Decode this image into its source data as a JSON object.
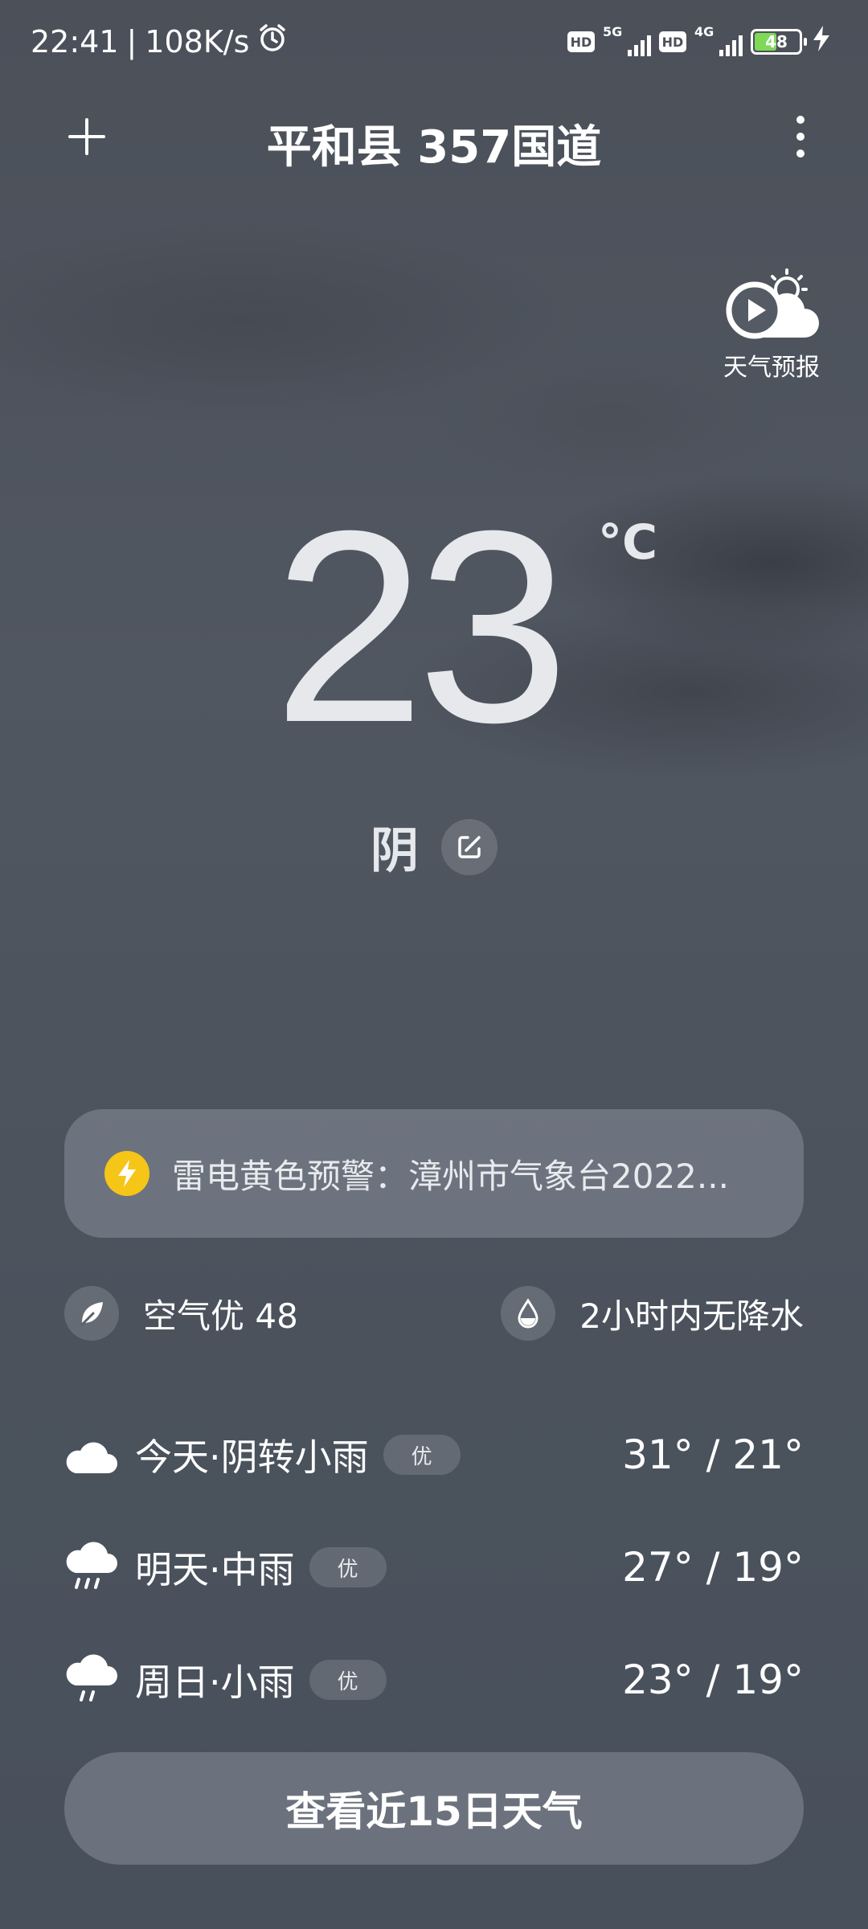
{
  "status_bar": {
    "time": "22:41",
    "separator": "|",
    "speed": "108K/s",
    "net1": "5G",
    "net2": "4G",
    "hd1": "HD",
    "hd2": "HD",
    "battery": "48",
    "icons": [
      "alarm-icon",
      "hd-icon",
      "signal-icon",
      "battery-icon",
      "charging-icon"
    ]
  },
  "header": {
    "title": "平和县 357国道"
  },
  "forecast_video": {
    "label": "天气预报"
  },
  "current": {
    "temperature": "23",
    "unit": "°C",
    "condition": "阴"
  },
  "warning": {
    "text": "雷电黄色预警：漳州市气象台2022..."
  },
  "air_quality": {
    "text": "空气优 48"
  },
  "precipitation": {
    "text": "2小时内无降水"
  },
  "forecast": [
    {
      "label": "今天·阴转小雨",
      "aq": "优",
      "temps": "31° / 21°",
      "icon": "cloud-icon"
    },
    {
      "label": "明天·中雨",
      "aq": "优",
      "temps": "27° / 19°",
      "icon": "moderate-rain-icon"
    },
    {
      "label": "周日·小雨",
      "aq": "优",
      "temps": "23° / 19°",
      "icon": "light-rain-icon"
    }
  ],
  "bottom_button": {
    "label": "查看近15日天气"
  }
}
